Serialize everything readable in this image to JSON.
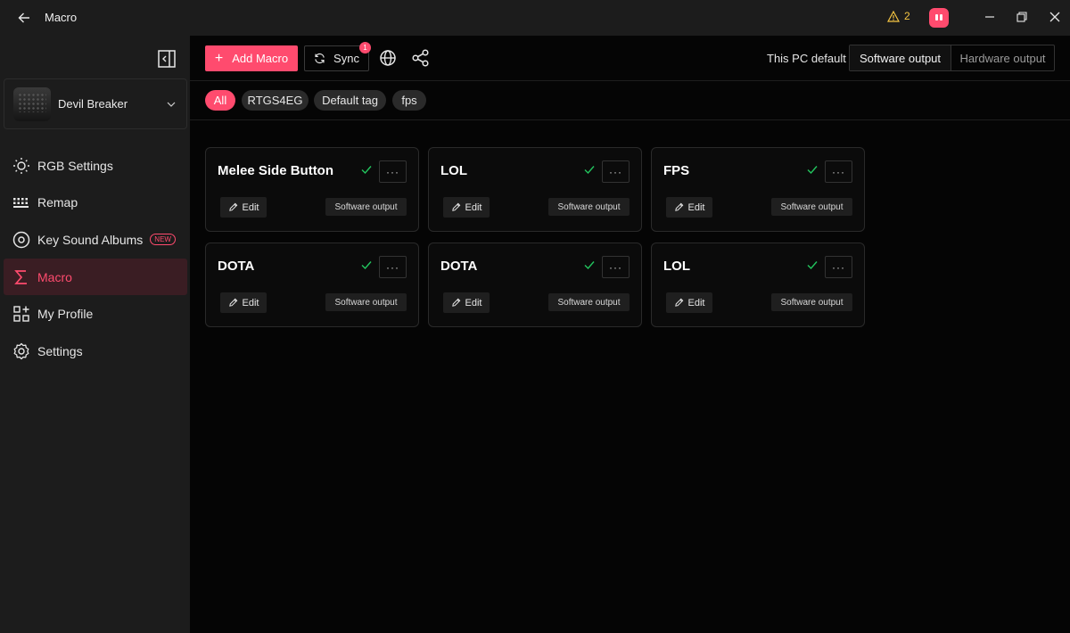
{
  "window": {
    "title": "Macro",
    "warning_count": "2",
    "colors": {
      "accent": "#ff4b6e",
      "warning": "#f5c542",
      "success": "#22c55e"
    }
  },
  "sidebar": {
    "device_name": "Devil Breaker",
    "items": [
      {
        "label": "RGB Settings",
        "icon": "sun-icon"
      },
      {
        "label": "Remap",
        "icon": "keyboard-icon"
      },
      {
        "label": "Key Sound Albums",
        "icon": "disc-icon",
        "badge": "NEW"
      },
      {
        "label": "Macro",
        "icon": "sigma-icon",
        "active": true
      },
      {
        "label": "My Profile",
        "icon": "grid-icon"
      },
      {
        "label": "Settings",
        "icon": "gear-icon"
      }
    ]
  },
  "toolbar": {
    "add_label": "Add Macro",
    "sync_label": "Sync",
    "sync_badge": "1",
    "pc_default_label": "This PC default",
    "output_options": [
      "Software output",
      "Hardware output"
    ],
    "selected_output": "Software output"
  },
  "filters": [
    {
      "label": "All",
      "active": true
    },
    {
      "label": "RTGS4EG"
    },
    {
      "label": "Default tag"
    },
    {
      "label": "fps"
    }
  ],
  "macros": [
    {
      "title": "Melee Side Button",
      "edit_label": "Edit",
      "output": "Software output",
      "enabled": true
    },
    {
      "title": "LOL",
      "edit_label": "Edit",
      "output": "Software output",
      "enabled": true
    },
    {
      "title": "FPS",
      "edit_label": "Edit",
      "output": "Software output",
      "enabled": true
    },
    {
      "title": "DOTA",
      "edit_label": "Edit",
      "output": "Software output",
      "enabled": true
    },
    {
      "title": "DOTA",
      "edit_label": "Edit",
      "output": "Software output",
      "enabled": true
    },
    {
      "title": "LOL",
      "edit_label": "Edit",
      "output": "Software output",
      "enabled": true
    }
  ]
}
